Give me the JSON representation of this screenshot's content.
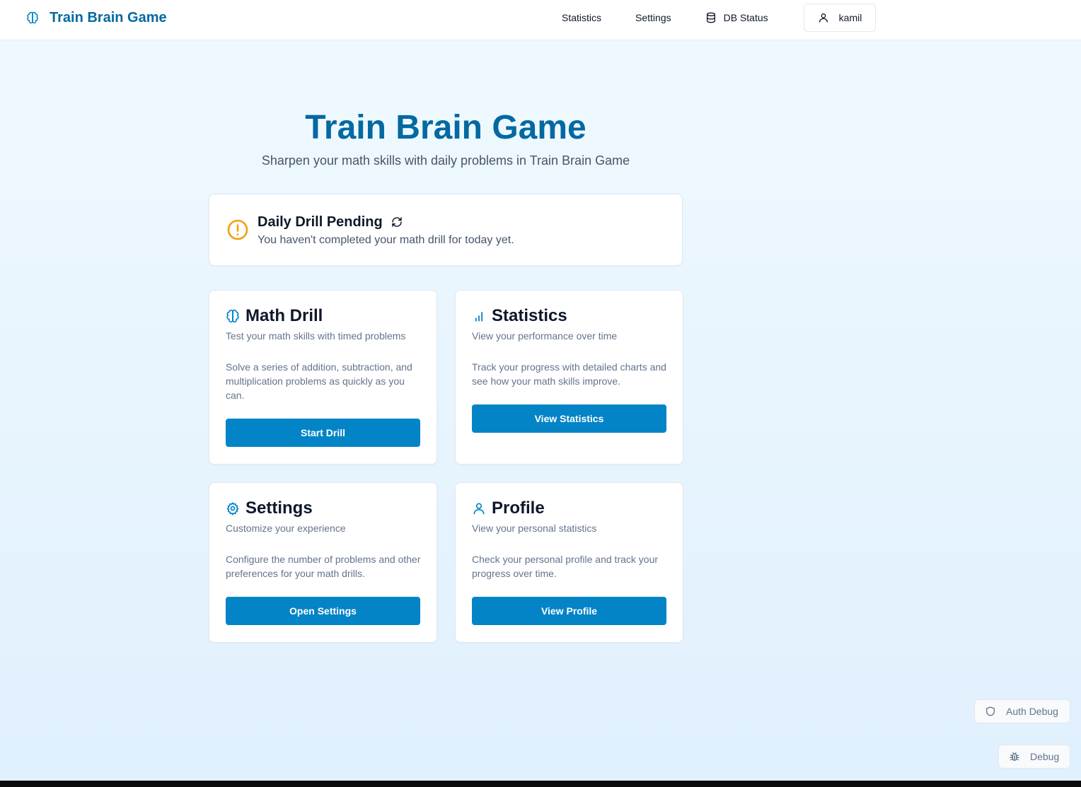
{
  "colors": {
    "brand": "#0369a1",
    "primary_button": "#0284c7",
    "warning": "#f59e0b",
    "background": "#eaf5fd"
  },
  "header": {
    "brand_icon": "brain-icon",
    "brand_title": "Train Brain Game",
    "nav": {
      "statistics": "Statistics",
      "settings": "Settings",
      "db_status": "DB Status",
      "db_icon": "database-icon"
    },
    "user": {
      "icon": "user-icon",
      "name": "kamil"
    }
  },
  "hero": {
    "title": "Train Brain Game",
    "subtitle": "Sharpen your math skills with daily problems in Train Brain Game"
  },
  "alert": {
    "icon": "alert-circle-icon",
    "title": "Daily Drill Pending",
    "refresh_icon": "refresh-icon",
    "description": "You haven't completed your math drill for today yet."
  },
  "cards": [
    {
      "icon": "brain-icon",
      "title": "Math Drill",
      "subtitle": "Test your math skills with timed problems",
      "body": "Solve a series of addition, subtraction, and multiplication problems as quickly as you can.",
      "button": "Start Drill"
    },
    {
      "icon": "bar-chart-icon",
      "title": "Statistics",
      "subtitle": "View your performance over time",
      "body": "Track your progress with detailed charts and see how your math skills improve.",
      "button": "View Statistics"
    },
    {
      "icon": "gear-icon",
      "title": "Settings",
      "subtitle": "Customize your experience",
      "body": "Configure the number of problems and other preferences for your math drills.",
      "button": "Open Settings"
    },
    {
      "icon": "user-icon",
      "title": "Profile",
      "subtitle": "View your personal statistics",
      "body": "Check your personal profile and track your progress over time.",
      "button": "View Profile"
    }
  ],
  "debug": {
    "auth_debug": "Auth Debug",
    "auth_icon": "shield-icon",
    "debug": "Debug",
    "debug_icon": "bug-icon"
  }
}
